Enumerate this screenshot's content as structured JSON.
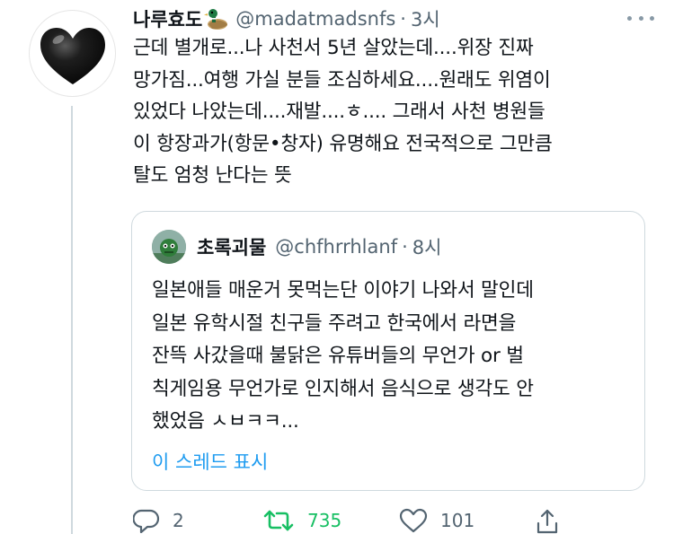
{
  "tweet": {
    "display_name": "나루효도",
    "emoji_icon": "duck-icon",
    "handle": "@madatmadsnfs",
    "separator": "·",
    "time": "3시",
    "lines": [
      "근데 별개로...나 사천서 5년 살았는데....위장 진짜",
      "망가짐...여행 가실 분들 조심하세요....원래도 위염이",
      "있었다 나았는데....재발....ㅎ.... 그래서 사천 병원들",
      "이 항장과가(항문•창자) 유명해요 전국적으로 그만큼",
      "탈도 엄청 난다는 뜻"
    ]
  },
  "quote": {
    "display_name": "초록괴물",
    "handle": "@chfhrrhlanf",
    "separator": "·",
    "time": "8시",
    "lines": [
      "일본애들 매운거 못먹는단 이야기 나와서 말인데",
      "일본 유학시절 친구들 주려고 한국에서 라면을",
      "잔뜩 사갔을때 불닭은 유튜버들의 무언가 or 벌",
      "칙게임용 무언가로 인지해서 음식으로 생각도 안",
      "했었음 ㅅㅂㅋㅋ..."
    ],
    "show_thread": "이 스레드 표시"
  },
  "actions": {
    "reply_count": "2",
    "retweet_count": "735",
    "like_count": "101"
  },
  "colors": {
    "accent": "#1d9bf0",
    "retweet": "#17bf63",
    "secondary_text": "#536471"
  }
}
